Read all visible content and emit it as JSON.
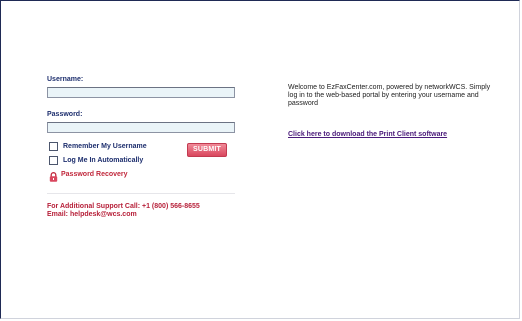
{
  "login": {
    "username_label": "Username:",
    "username_value": "",
    "password_label": "Password:",
    "password_value": "",
    "remember_label": "Remember My Username",
    "remember_checked": false,
    "auto_login_label": "Log Me In Automatically",
    "auto_login_checked": false,
    "submit_label": "SUBMIT",
    "recovery_label": "Password Recovery"
  },
  "support": {
    "phone_line": "For Additional Support Call: +1 (800) 566-8655",
    "email_line": "Email: helpdesk@wcs.com"
  },
  "info": {
    "welcome_text": "Welcome to EzFaxCenter.com, powered by networkWCS. Simply log in to the web-based portal by entering your username and password",
    "download_link": "Click here to download the Print Client software"
  },
  "colors": {
    "label_text": "#1e2f6e",
    "accent_red": "#c0283c",
    "link": "#4a1a7a",
    "field_bg": "#eaf4f8"
  },
  "icons": {
    "recovery": "lock-icon"
  }
}
